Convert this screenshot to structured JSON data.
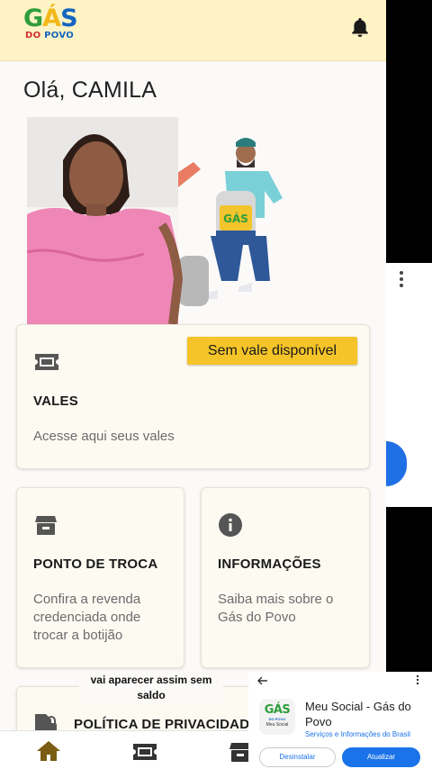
{
  "app": {
    "logo_top": "GÁS",
    "logo_bottom": "DO POVO",
    "greeting": "Olá, CAMILA"
  },
  "vales_card": {
    "badge": "Sem vale disponível",
    "title": "VALES",
    "description": "Acesse aqui seus vales"
  },
  "ponto_card": {
    "title": "PONTO DE TROCA",
    "description_lines": [
      "Confira a revenda",
      "credenciada onde",
      "trocar a botijão"
    ]
  },
  "info_card": {
    "title": "INFORMAÇÕES",
    "description_lines": [
      "Saiba mais sobre o",
      "Gás do Povo"
    ]
  },
  "privacy_card": {
    "title": "POLÍTICA DE PRIVACIDADE"
  },
  "video_caption": {
    "lines": [
      "vai aparecer assim sem",
      "saldo"
    ]
  },
  "bottom_nav": {
    "items": [
      {
        "icon": "home-icon"
      },
      {
        "icon": "ticket-icon"
      },
      {
        "icon": "store-icon"
      }
    ]
  },
  "store_popup": {
    "app_title_lines": [
      "Meu Social - Gás do",
      "Povo"
    ],
    "publisher": "Serviços e Informações do Brasil",
    "uninstall_label": "Desinstalar",
    "update_label": "Atualizar",
    "logo_top": "GÁS",
    "logo_bottom": "DO POVO",
    "logo_caption": "Meu Social"
  },
  "colors": {
    "header_bg": "#fdf3c4",
    "badge_bg": "#f5c428",
    "accent_blue": "#1a73e8",
    "icon_gray": "#555555"
  }
}
